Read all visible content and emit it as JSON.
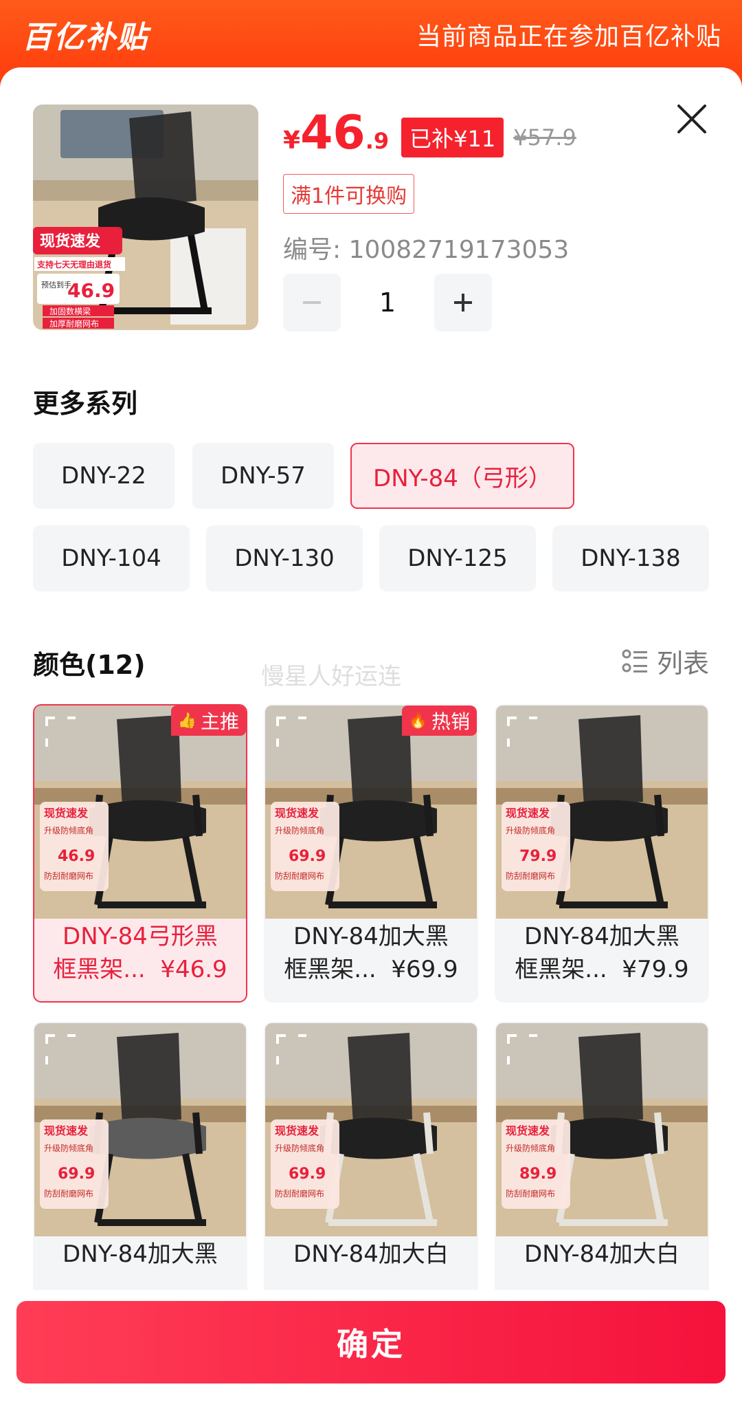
{
  "banner": {
    "logo_text": "百亿补贴",
    "notice": "当前商品正在参加百亿补贴"
  },
  "product": {
    "price_symbol": "¥",
    "price_int": "46",
    "price_dec": ".9",
    "subsidy": "已补¥11",
    "original_price": "¥57.9",
    "promo": "满1件可换购",
    "sku_code": "编号: 10082719173053",
    "quantity": "1"
  },
  "series": {
    "title": "更多系列",
    "items": [
      "DNY-22",
      "DNY-57",
      "DNY-84（弓形）",
      "DNY-104",
      "DNY-130",
      "DNY-125",
      "DNY-138"
    ],
    "selected_index": 2
  },
  "colors": {
    "title": "颜色(12)",
    "list_label": "列表",
    "watermark": "慢星人好运连",
    "items": [
      {
        "line1": "DNY-84弓形黑",
        "line2": "框黑架...  ¥46.9",
        "badge": "主推",
        "selected": true,
        "frame": "black",
        "seat": "black"
      },
      {
        "line1": "DNY-84加大黑",
        "line2": "框黑架...  ¥69.9",
        "badge": "热销",
        "selected": false,
        "frame": "black",
        "seat": "black"
      },
      {
        "line1": "DNY-84加大黑",
        "line2": "框黑架...  ¥79.9",
        "badge": "",
        "selected": false,
        "frame": "black",
        "seat": "black"
      },
      {
        "line1": "DNY-84加大黑",
        "line2": "",
        "badge": "",
        "selected": false,
        "frame": "black",
        "seat": "grey"
      },
      {
        "line1": "DNY-84加大白",
        "line2": "",
        "badge": "",
        "selected": false,
        "frame": "white",
        "seat": "black"
      },
      {
        "line1": "DNY-84加大白",
        "line2": "",
        "badge": "",
        "selected": false,
        "frame": "white",
        "seat": "black"
      }
    ]
  },
  "image_overlays": {
    "main": [
      "现货速发",
      "支持七天无理由退货",
      "预估到手",
      "46.9",
      "加固数横梁",
      "加厚耐磨网布"
    ],
    "card_prices": [
      "46.9",
      "69.9",
      "79.9",
      "69.9",
      "69.9",
      "89.9"
    ],
    "card_line1": "现货速发",
    "card_line2": "升级防倾底角",
    "card_line3": "防刮耐磨网布"
  },
  "footer": {
    "confirm": "确定"
  },
  "theme": {
    "accent": "#f0344c",
    "banner": "#ff4a12"
  }
}
